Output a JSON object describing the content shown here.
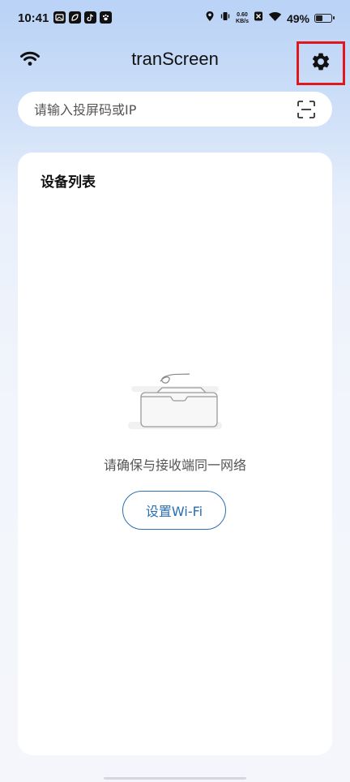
{
  "status_bar": {
    "time": "10:41",
    "net_speed_value": "0.60",
    "net_speed_unit": "KB/s",
    "battery_percent": "49%",
    "battery_level": 0.49,
    "icons": [
      "gallery-icon",
      "leaf-icon",
      "tiktok-icon",
      "paw-icon",
      "location-icon",
      "vibrate-icon",
      "data-saver-icon",
      "wifi-icon",
      "battery-icon"
    ]
  },
  "header": {
    "title": "tranScreen",
    "left_icon": "wifi-icon",
    "right_icon": "gear-icon",
    "highlight_color": "#e0171c"
  },
  "search": {
    "placeholder": "请输入投屏码或IP",
    "value": "",
    "scan_icon": "scan-icon"
  },
  "device_list": {
    "title": "设备列表",
    "empty_icon": "empty-box-icon",
    "empty_message": "请确保与接收端同一网络",
    "wifi_button_label": "设置Wi-Fi",
    "accent_color": "#2a6fb0"
  }
}
